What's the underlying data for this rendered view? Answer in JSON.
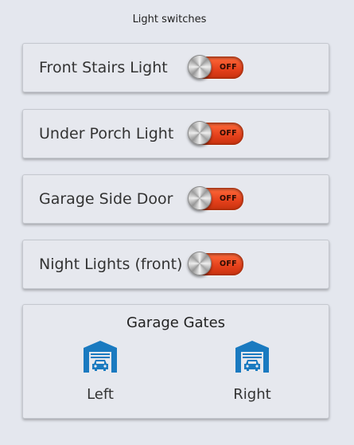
{
  "page": {
    "title": "Light switches"
  },
  "switches": [
    {
      "label": "Front Stairs Light",
      "state": "OFF"
    },
    {
      "label": "Under Porch Light",
      "state": "OFF"
    },
    {
      "label": "Garage Side Door",
      "state": "OFF"
    },
    {
      "label": "Night Lights (front)",
      "state": "OFF"
    }
  ],
  "gates": {
    "title": "Garage Gates",
    "items": [
      {
        "label": "Left",
        "icon": "garage-icon"
      },
      {
        "label": "Right",
        "icon": "garage-icon"
      }
    ]
  },
  "colors": {
    "background": "#e4e7ee",
    "toggle_off": "#e4401b",
    "garage_icon": "#1a7ac0"
  }
}
